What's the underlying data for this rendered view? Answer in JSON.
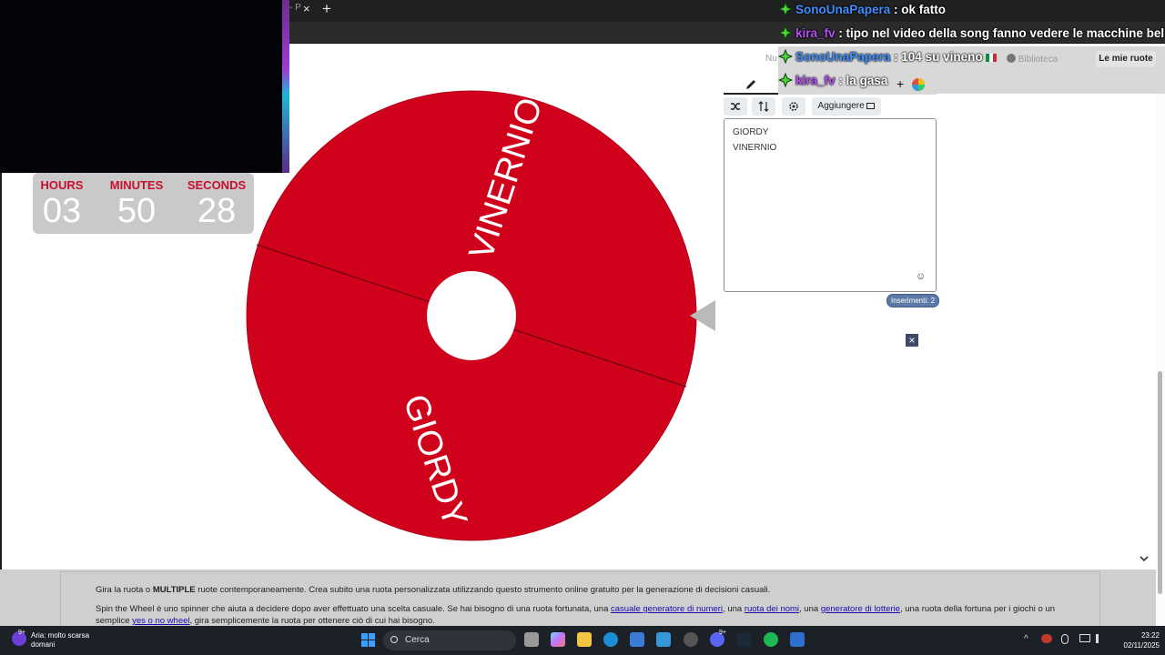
{
  "browser": {
    "tab_fragment": "- P",
    "tab_close": "×",
    "new_tab": "+"
  },
  "timer": {
    "hours_label": "HOURS",
    "minutes_label": "MINUTES",
    "seconds_label": "SECONDS",
    "hours": "03",
    "minutes": "50",
    "seconds": "28"
  },
  "wheel": {
    "segments": [
      "VINERNIO",
      "GIORDY"
    ],
    "color": "#d0021b"
  },
  "page_fragment": "Nu",
  "editor": {
    "toolbar_add": "Aggiungere",
    "entries": [
      "GIORDY",
      "VINERNIO"
    ],
    "count": "Inserimenti: 2",
    "emoji": "☺",
    "close": "×"
  },
  "behind_bar": {
    "library": "Biblioteca",
    "my_wheels": "Le mie ruote",
    "plus": "+"
  },
  "chat": [
    {
      "user": "SonoUnaPapera",
      "text": ": ok fatto",
      "color": "blue"
    },
    {
      "user": "kira_fv",
      "text": ": tipo nel video della song fanno vedere le macchine belle e",
      "color": "purple"
    },
    {
      "user": "SonoUnaPapera",
      "text": ": 104 su vineno",
      "color": "blue",
      "flag": "it"
    },
    {
      "user": "kira_fv",
      "text": ": la gasa",
      "color": "purple"
    }
  ],
  "footer": {
    "line1_a": "Gira la ruota o ",
    "line1_bold": "MULTIPLE",
    "line1_b": " ruote contemporaneamente. Crea subito una ruota personalizzata utilizzando questo strumento online gratuito per la generazione di decisioni casuali.",
    "line2_a": "Spin the Wheel è uno spinner che aiuta a decidere dopo aver effettuato una scelta casuale. Se hai bisogno di una ruota fortunata, una ",
    "link1": "casuale generatore di numeri",
    "line2_b": ", una ",
    "link2": "ruota dei nomi",
    "line2_c": ", una ",
    "link3": "generatore di lotterie",
    "line2_d": ", una ruota della fortuna per i giochi o un",
    "line3_a": "semplice ",
    "link4": "yes o no wheel",
    "line3_b": ", gira semplicemente la ruota per ottenere ciò di cui hai bisogno."
  },
  "taskbar": {
    "weather_line1": "Aria: molto scarsa",
    "weather_line2": "domani",
    "weather_badge": "9+",
    "search": "Cerca",
    "time": "23:22",
    "date": "02/11/2025",
    "discord_badge": "9+"
  }
}
